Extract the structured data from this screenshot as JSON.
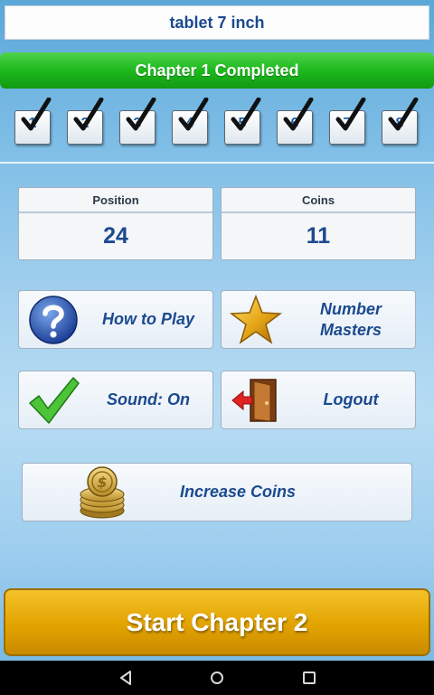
{
  "header": {
    "title": "tablet 7 inch"
  },
  "chapter": {
    "status": "Chapter 1 Completed"
  },
  "levels": [
    {
      "label": "1",
      "completed": true
    },
    {
      "label": "2",
      "completed": true
    },
    {
      "label": "3",
      "completed": true
    },
    {
      "label": "4",
      "completed": true
    },
    {
      "label": "5",
      "completed": true
    },
    {
      "label": "6",
      "completed": true
    },
    {
      "label": "7",
      "completed": true
    },
    {
      "label": "8",
      "completed": true
    }
  ],
  "stats": {
    "position": {
      "label": "Position",
      "value": "24"
    },
    "coins": {
      "label": "Coins",
      "value": "11"
    }
  },
  "menu": {
    "how_to_play": {
      "label": "How to Play",
      "icon": "question-icon"
    },
    "number_masters": {
      "label": "Number Masters",
      "icon": "star-icon"
    },
    "sound": {
      "label": "Sound: On",
      "icon": "checkmark-icon"
    },
    "logout": {
      "label": "Logout",
      "icon": "door-exit-icon"
    },
    "increase_coins": {
      "label": "Increase Coins",
      "icon": "coins-icon"
    }
  },
  "start_button": {
    "label": "Start Chapter 2"
  },
  "colors": {
    "accent_blue": "#1b4a8f",
    "chapter_green": "#1db91d",
    "start_gold": "#e2a300"
  }
}
